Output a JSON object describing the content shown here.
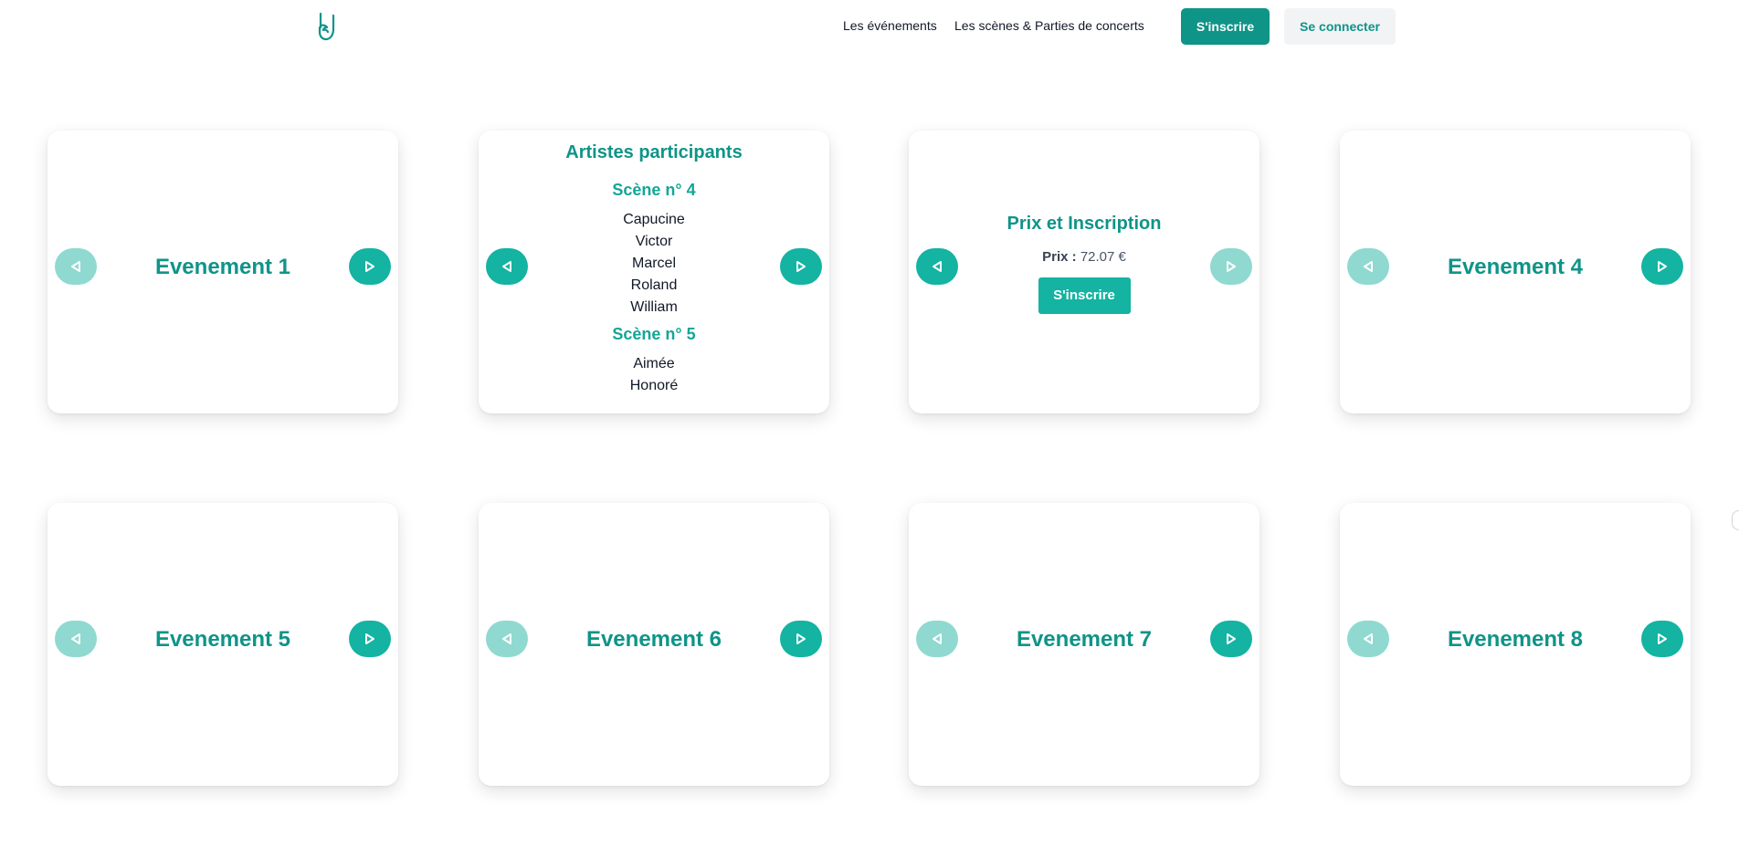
{
  "header": {
    "logo_icon": "rock-hand-icon",
    "nav": [
      "Les événements",
      "Les scènes & Parties de concerts"
    ],
    "signup_label": "S'inscrire",
    "login_label": "Se connecter"
  },
  "colors": {
    "accent": "#0f9488",
    "arrow_active": "#14b3a2",
    "arrow_disabled": "#8fd9d0",
    "login_bg": "#f1f3f5"
  },
  "cards": [
    {
      "title": "Evenement 1"
    },
    {
      "title": "Artistes participants",
      "scenes": [
        {
          "label": "Scène n° 4",
          "artists": [
            "Capucine",
            "Victor",
            "Marcel",
            "Roland",
            "William"
          ]
        },
        {
          "label": "Scène n° 5",
          "artists": [
            "Aimée",
            "Honoré"
          ]
        }
      ]
    },
    {
      "title": "Prix et Inscription",
      "price_label": "Prix :",
      "price_value": "72.07 €",
      "button_label": "S'inscrire"
    },
    {
      "title": "Evenement 4"
    },
    {
      "title": "Evenement 5"
    },
    {
      "title": "Evenement 6"
    },
    {
      "title": "Evenement 7"
    },
    {
      "title": "Evenement 8"
    }
  ]
}
